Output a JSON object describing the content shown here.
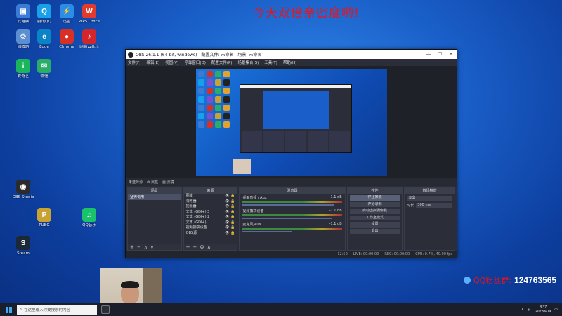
{
  "headline": "今天双倍亲密度哟!",
  "desktop_icons": [
    {
      "label": "此电脑",
      "color": "#3a7bd5",
      "glyph": "▣"
    },
    {
      "label": "腾讯QQ",
      "color": "#1aa0e8",
      "glyph": "Q"
    },
    {
      "label": "迅雷",
      "color": "#2c8de8",
      "glyph": "⚡"
    },
    {
      "label": "WPS Office",
      "color": "#e23b2e",
      "glyph": "W"
    },
    {
      "label": "回收站",
      "color": "#5c8fd1",
      "glyph": "♲"
    },
    {
      "label": "Edge",
      "color": "#0a84c6",
      "glyph": "e"
    },
    {
      "label": "Chrome",
      "color": "#d93025",
      "glyph": "●"
    },
    {
      "label": "网易云音乐",
      "color": "#d3262b",
      "glyph": "♪"
    },
    {
      "label": "爱奇艺",
      "color": "#1bb55c",
      "glyph": "i"
    },
    {
      "label": "微信",
      "color": "#2aae67",
      "glyph": "✉"
    },
    {
      "label": "OBS Studio",
      "color": "#2b2b2b",
      "glyph": "◉"
    },
    {
      "label": "PUBG",
      "color": "#c9a234",
      "glyph": "P"
    },
    {
      "label": "Steam",
      "color": "#1b2838",
      "glyph": "S"
    },
    {
      "label": "QQ音乐",
      "color": "#19c26b",
      "glyph": "♫"
    }
  ],
  "obs": {
    "title": "OBS 26.1.1 (64-bit, windows) - 配置文件: 未命名 - 场景: 未命名",
    "window_controls": [
      "—",
      "☐",
      "✕"
    ],
    "menu": [
      "文件(F)",
      "编辑(E)",
      "视图(V)",
      "停靠窗口(D)",
      "配置文件(P)",
      "场景集合(S)",
      "工具(T)",
      "帮助(H)"
    ],
    "source_toolbar": [
      "未选择源",
      "⚙ 属性",
      "▦ 滤镜"
    ],
    "docks": {
      "scenes": {
        "title": "场景",
        "items": [
          "猛男专用"
        ]
      },
      "sources": {
        "title": "来源",
        "items": [
          "图库",
          "浏览器",
          "拍摄器",
          "文本 (GDI+) 3",
          "文本 (GDI+) 2",
          "文本 (GDI+)",
          "视频捕获设备",
          "OBS源"
        ]
      },
      "mixer": {
        "title": "混音器",
        "rows": [
          {
            "name": "桌面音频 / Aux",
            "db": "-1.1 dB",
            "level": 0.92
          },
          {
            "name": "视频捕获设备",
            "db": "-1.1 dB",
            "level": 0.9
          },
          {
            "name": "麦克风/Aux",
            "db": "-1.1 dB",
            "level": 0.5
          }
        ]
      },
      "transitions": {
        "title": "转场特效",
        "type": "淡出",
        "duration_label": "时长",
        "duration_value": "300 ms"
      },
      "controls": {
        "title": "控件",
        "buttons": [
          "停止推流",
          "开始录制",
          "启动虚拟摄像机",
          "工作室模式",
          "设置",
          "退出"
        ]
      }
    },
    "status": {
      "dropped": "12:50",
      "live": "LIVE: 00:00:00",
      "rec": "REC: 00:00:00",
      "cpu": "CPU: 0.7%, 40.00 fps"
    }
  },
  "qq_group": {
    "label": "QQ粉丝群:",
    "number": "124763565"
  },
  "taskbar": {
    "search_placeholder": "在这里输入你要搜索的内容",
    "clock_time": "8:37",
    "clock_date": "2022/6/19"
  }
}
